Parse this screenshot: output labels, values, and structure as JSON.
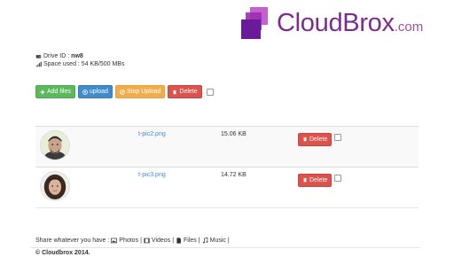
{
  "brand": {
    "name": "CloudBrox",
    "domain": ".com",
    "color": "#7b2d8e"
  },
  "drive": {
    "id_label": "Drive ID :",
    "id_value": "nw8",
    "space_label": "Space used : 54 KB/500 MBs"
  },
  "toolbar": {
    "add_label": "Add files",
    "upload_label": "upload",
    "stop_label": "Stop Upload",
    "delete_label": "Delete"
  },
  "files": [
    {
      "name": "t-pic2.png",
      "size": "15.06 KB",
      "delete_label": "Delete"
    },
    {
      "name": "t-pic3.png",
      "size": "14.72 KB",
      "delete_label": "Delete"
    }
  ],
  "share": {
    "prefix": "Share whatever you have :",
    "photos": "Photos",
    "videos": "Videos",
    "files": "Files",
    "music": "Music"
  },
  "footer": {
    "text": "© Cloudbrox 2014."
  },
  "colors": {
    "success": "#5cb85c",
    "primary": "#428bca",
    "warning": "#f0ad4e",
    "danger": "#d9534f"
  }
}
